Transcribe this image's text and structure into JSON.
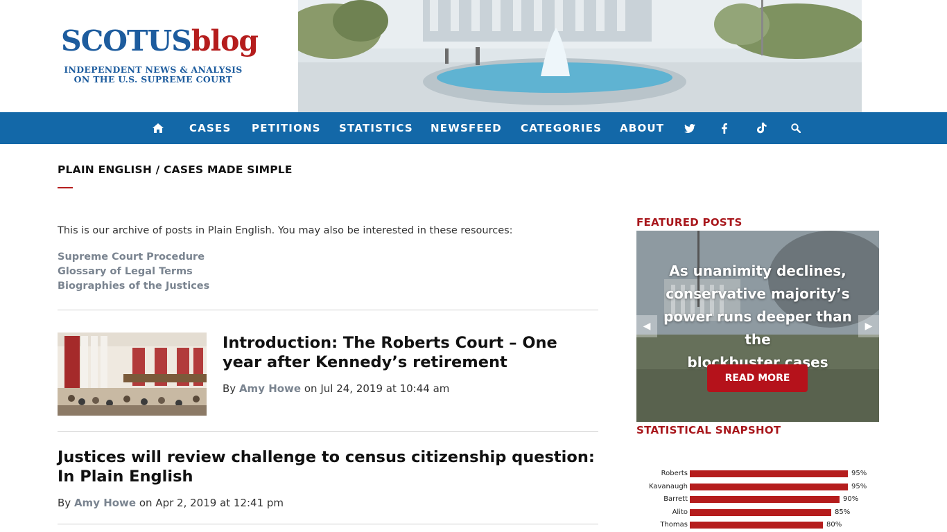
{
  "logo": {
    "name_part1": "SCOTUS",
    "name_part2": "blog",
    "tagline_line1": "INDEPENDENT NEWS & ANALYSIS",
    "tagline_line2": "ON THE U.S. SUPREME COURT"
  },
  "nav": {
    "items": [
      "CASES",
      "PETITIONS",
      "STATISTICS",
      "NEWSFEED",
      "CATEGORIES",
      "ABOUT"
    ],
    "icons": [
      "home-icon",
      "twitter-icon",
      "facebook-icon",
      "tiktok-icon",
      "search-icon"
    ]
  },
  "page": {
    "title": "PLAIN ENGLISH / CASES MADE SIMPLE",
    "intro": "This is our archive of posts in Plain English. You may also be interested in these resources:",
    "resources": [
      "Supreme Court Procedure",
      "Glossary of Legal Terms",
      "Biographies of the Justices"
    ]
  },
  "posts": [
    {
      "title_line1": "Introduction: The Roberts Court – One",
      "title_line2": "year after Kennedy’s retirement",
      "by": "By",
      "author": "Amy Howe",
      "date": "on Jul 24, 2019 at 10:44 am"
    },
    {
      "title_line1": "Justices will review challenge to census citizenship question:",
      "title_line2": "In Plain English",
      "by": "By",
      "author": "Amy Howe",
      "date": "on Apr 2, 2019 at 12:41 pm"
    }
  ],
  "sidebar": {
    "featured_heading": "FEATURED POSTS",
    "featured_title_line1": "As unanimity declines,",
    "featured_title_line2": "conservative majority’s",
    "featured_title_line3": "power runs deeper than the",
    "featured_title_line4": "blockbuster cases",
    "read_more": "READ MORE",
    "prev_arrow": "◀",
    "next_arrow": "▶",
    "snapshot_heading": "STATISTICAL SNAPSHOT"
  },
  "colors": {
    "nav": "#1368a8",
    "accent_red": "#b51d1d",
    "link_gray": "#7a8490"
  },
  "chart_data": {
    "type": "bar",
    "orientation": "horizontal",
    "categories": [
      "Roberts",
      "Kavanaugh",
      "Barrett",
      "Alito",
      "Thomas"
    ],
    "values": [
      95,
      95,
      90,
      85,
      80
    ],
    "value_labels": [
      "95%",
      "95%",
      "90%",
      "85%",
      "80%"
    ],
    "xlim": [
      0,
      100
    ]
  }
}
